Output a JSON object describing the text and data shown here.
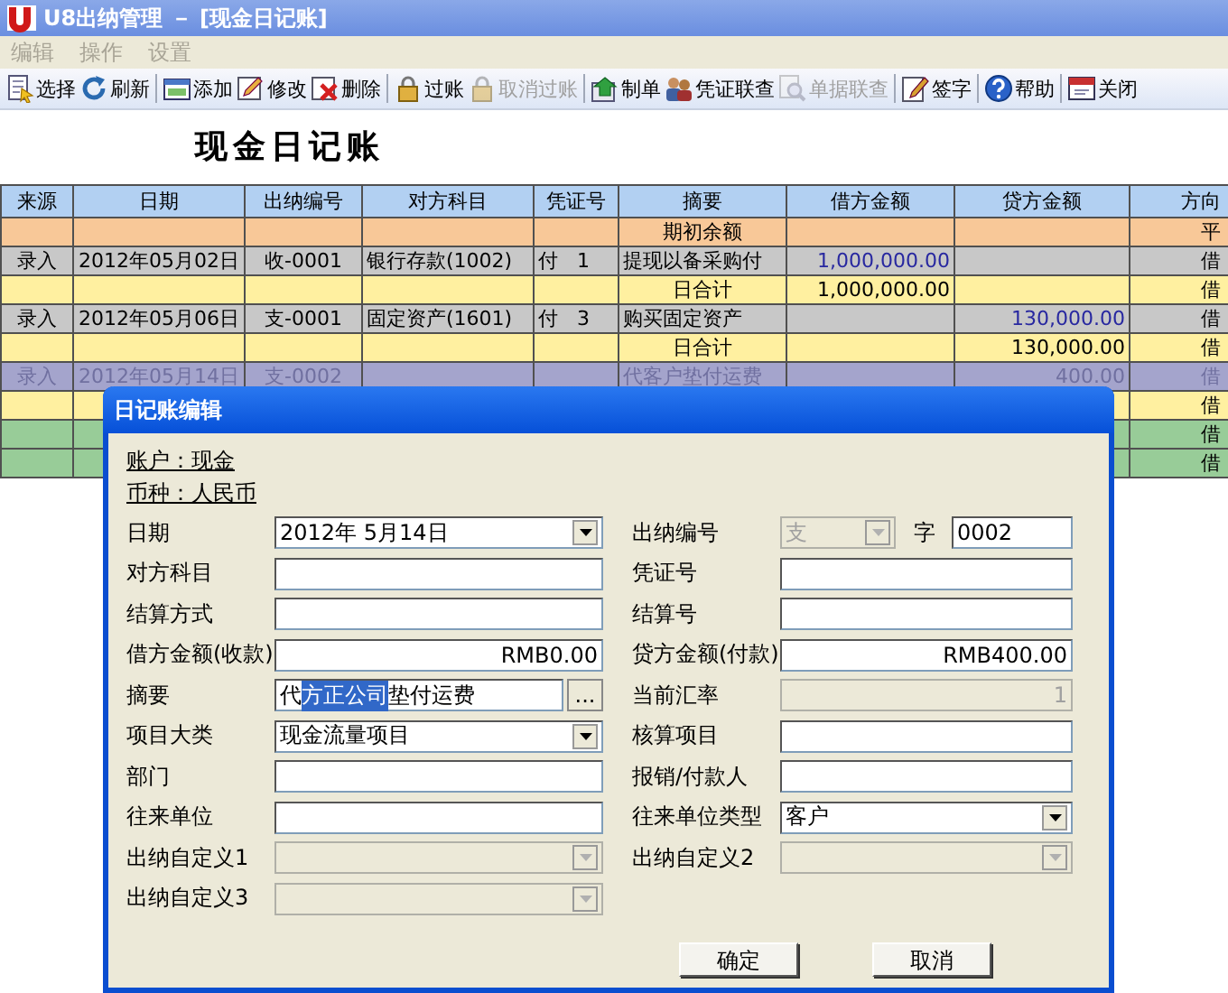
{
  "window": {
    "title": "U8出纳管理 － [现金日记账]"
  },
  "menu": [
    {
      "label": "编辑",
      "disabled": true
    },
    {
      "label": "操作",
      "disabled": true
    },
    {
      "label": "设置",
      "disabled": true
    }
  ],
  "toolbar": [
    [
      {
        "label": "选择",
        "disabled": false
      },
      {
        "label": "刷新",
        "disabled": false
      }
    ],
    [
      {
        "label": "添加",
        "disabled": false
      },
      {
        "label": "修改",
        "disabled": false
      },
      {
        "label": "删除",
        "disabled": false
      }
    ],
    [
      {
        "label": "过账",
        "disabled": false
      },
      {
        "label": "取消过账",
        "disabled": true
      }
    ],
    [
      {
        "label": "制单",
        "disabled": false
      },
      {
        "label": "凭证联查",
        "disabled": false
      },
      {
        "label": "单据联查",
        "disabled": true
      }
    ],
    [
      {
        "label": "签字",
        "disabled": false
      }
    ],
    [
      {
        "label": "帮助",
        "disabled": false
      }
    ],
    [
      {
        "label": "关闭",
        "disabled": false
      }
    ]
  ],
  "heading": "现金日记账",
  "ledger": {
    "columns": [
      "来源",
      "日期",
      "出纳编号",
      "对方科目",
      "凭证号",
      "摘要",
      "借方金额",
      "贷方金额",
      "方向"
    ],
    "rows": [
      {
        "kind": "opening",
        "summary": "期初余额",
        "direction": "平"
      },
      {
        "kind": "entry",
        "selected": false,
        "source": "录入",
        "date": "2012年05月02日",
        "cashier_no": "收-0001",
        "account": "银行存款(1002)",
        "voucher": "付   1",
        "summary": "提现以备采购付",
        "debit": "1,000,000.00",
        "direction": "借"
      },
      {
        "kind": "daily_total",
        "summary": "日合计",
        "debit": "1,000,000.00",
        "direction": "借"
      },
      {
        "kind": "entry",
        "selected": false,
        "source": "录入",
        "date": "2012年05月06日",
        "cashier_no": "支-0001",
        "account": "固定资产(1601)",
        "voucher": "付   3",
        "summary": "购买固定资产",
        "credit": "130,000.00",
        "direction": "借"
      },
      {
        "kind": "daily_total",
        "summary": "日合计",
        "credit": "130,000.00",
        "direction": "借"
      },
      {
        "kind": "entry",
        "selected": true,
        "source": "录入",
        "date": "2012年05月14日",
        "cashier_no": "支-0002",
        "summary": "代客户垫付运费",
        "credit": "400.00",
        "direction": "借"
      },
      {
        "kind": "daily_total",
        "direction": "借"
      },
      {
        "kind": "period_total",
        "direction": "借"
      },
      {
        "kind": "period_total",
        "direction": "借"
      }
    ]
  },
  "dialog": {
    "title": "日记账编辑",
    "account": "账户：现金",
    "currency": "币种：人民币",
    "fields": [
      {
        "label": "日期",
        "kind": "combo",
        "value": "2012年 5月14日",
        "disabled": false
      },
      {
        "label": "出纳编号",
        "kind": "code",
        "prefix": "支",
        "separator": "字",
        "value": "0002",
        "disabled": true
      },
      {
        "label": "对方科目",
        "kind": "text",
        "disabled": false
      },
      {
        "label": "凭证号",
        "kind": "text",
        "disabled": false
      },
      {
        "label": "结算方式",
        "kind": "text",
        "disabled": false
      },
      {
        "label": "结算号",
        "kind": "text",
        "disabled": false
      },
      {
        "label": "借方金额(收款)",
        "kind": "amount",
        "value": "RMB0.00",
        "disabled": false
      },
      {
        "label": "贷方金额(付款)",
        "kind": "amount",
        "value": "RMB400.00",
        "disabled": false
      },
      {
        "label": "摘要",
        "kind": "lookup",
        "before": "代",
        "selected_text": "方正公司",
        "after": "垫付运费",
        "button": "...",
        "disabled": false
      },
      {
        "label": "当前汇率",
        "kind": "amount",
        "value": "1",
        "disabled": true
      },
      {
        "label": "项目大类",
        "kind": "combo",
        "value": "现金流量项目",
        "disabled": false
      },
      {
        "label": "核算项目",
        "kind": "text",
        "disabled": false
      },
      {
        "label": "部门",
        "kind": "text",
        "disabled": false
      },
      {
        "label": "报销/付款人",
        "kind": "text",
        "disabled": false
      },
      {
        "label": "往来单位",
        "kind": "text",
        "disabled": false
      },
      {
        "label": "往来单位类型",
        "kind": "combo",
        "value": "客户",
        "disabled": false
      },
      {
        "label": "出纳自定义1",
        "kind": "combo",
        "disabled": true
      },
      {
        "label": "出纳自定义2",
        "kind": "combo",
        "disabled": true
      },
      {
        "label": "出纳自定义3",
        "kind": "combo",
        "disabled": true
      }
    ],
    "buttons": [
      "确定",
      "取消"
    ]
  }
}
